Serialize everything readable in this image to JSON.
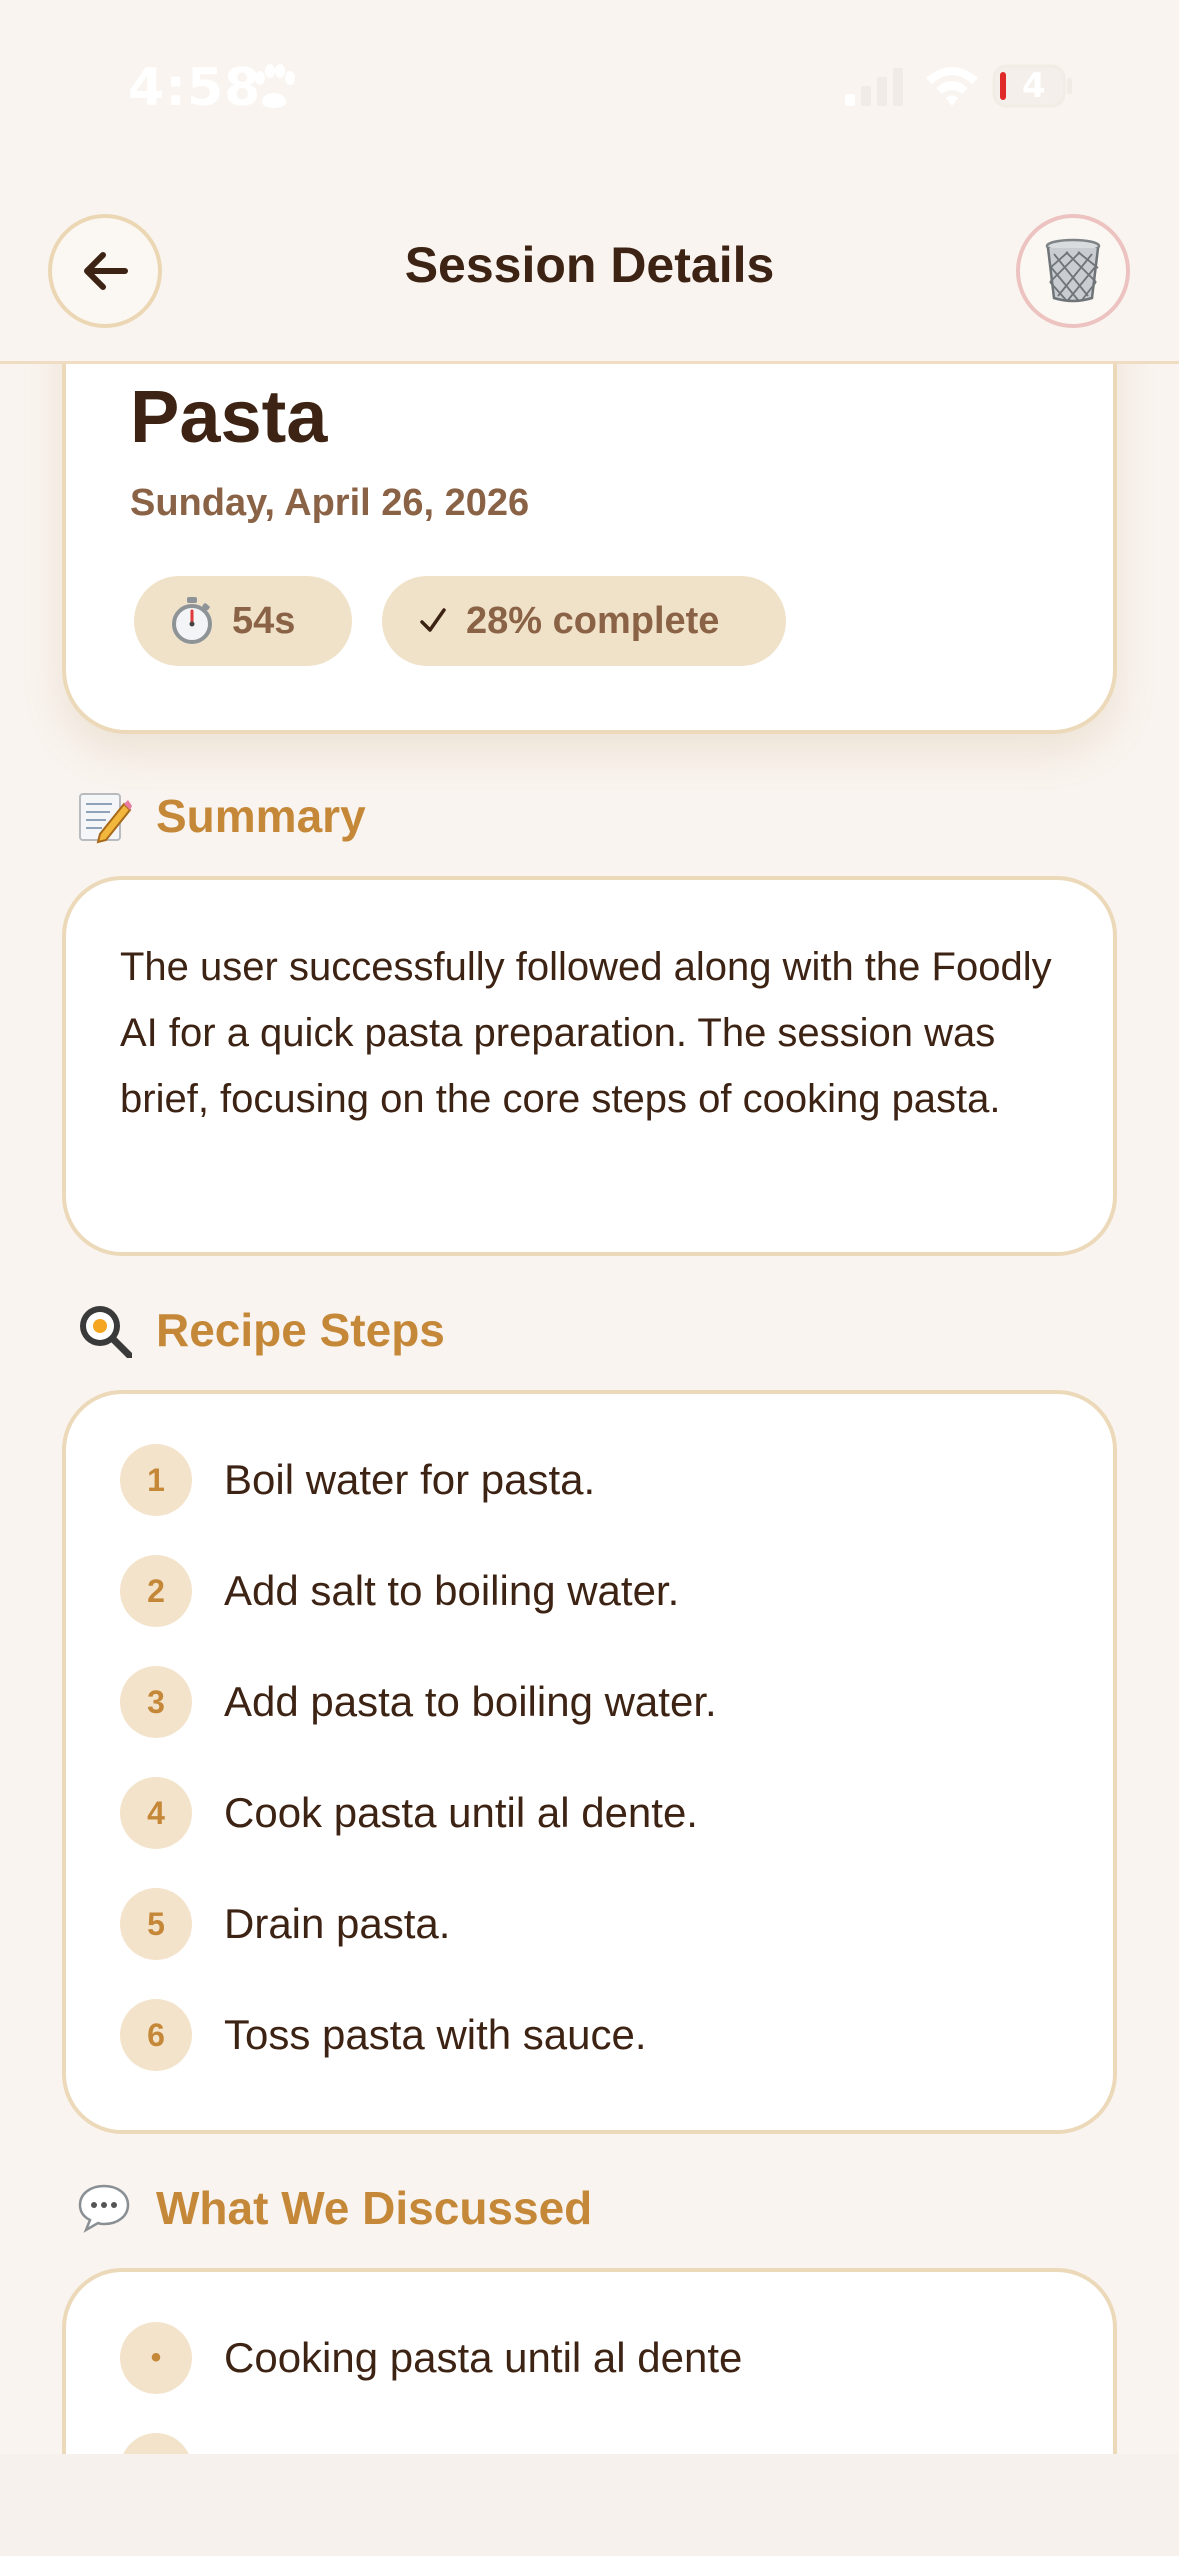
{
  "status_bar": {
    "time": "4:58",
    "battery": "4",
    "icons": [
      "paw-icon",
      "cellular-signal-icon",
      "wifi-icon",
      "battery-icon"
    ]
  },
  "nav": {
    "title": "Session Details",
    "back_icon": "arrow-left-icon",
    "trash_icon": "trash-can-icon"
  },
  "session": {
    "recipe_title": "Pasta",
    "date": "Sunday, April 26, 2026",
    "duration_icon": "stopwatch-icon",
    "duration": "54s",
    "progress_icon": "checkmark-icon",
    "progress_label": "28% complete"
  },
  "summary": {
    "heading": "Summary",
    "icon": "memo-icon",
    "text": "The user successfully followed along with the Foodly AI for a quick pasta preparation. The session was brief, focusing on the core steps of cooking pasta."
  },
  "steps": {
    "heading": "Recipe Steps",
    "icon": "frying-pan-icon",
    "items": [
      {
        "num": "1",
        "text": "Boil water for pasta."
      },
      {
        "num": "2",
        "text": "Add salt to boiling water."
      },
      {
        "num": "3",
        "text": "Add pasta to boiling water."
      },
      {
        "num": "4",
        "text": "Cook pasta until al dente."
      },
      {
        "num": "5",
        "text": "Drain pasta."
      },
      {
        "num": "6",
        "text": "Toss pasta with sauce."
      }
    ]
  },
  "discussed": {
    "heading": "What We Discussed",
    "icon": "speech-bubble-icon",
    "bullet": "•",
    "items": [
      {
        "text": "Cooking pasta until al dente"
      }
    ]
  },
  "colors": {
    "background": "#f9f4ef",
    "accent": "#c48838",
    "text": "#3d2314",
    "muted": "#8a6246",
    "chip": "#f0e2c9",
    "card_border": "#ecd9b9"
  }
}
